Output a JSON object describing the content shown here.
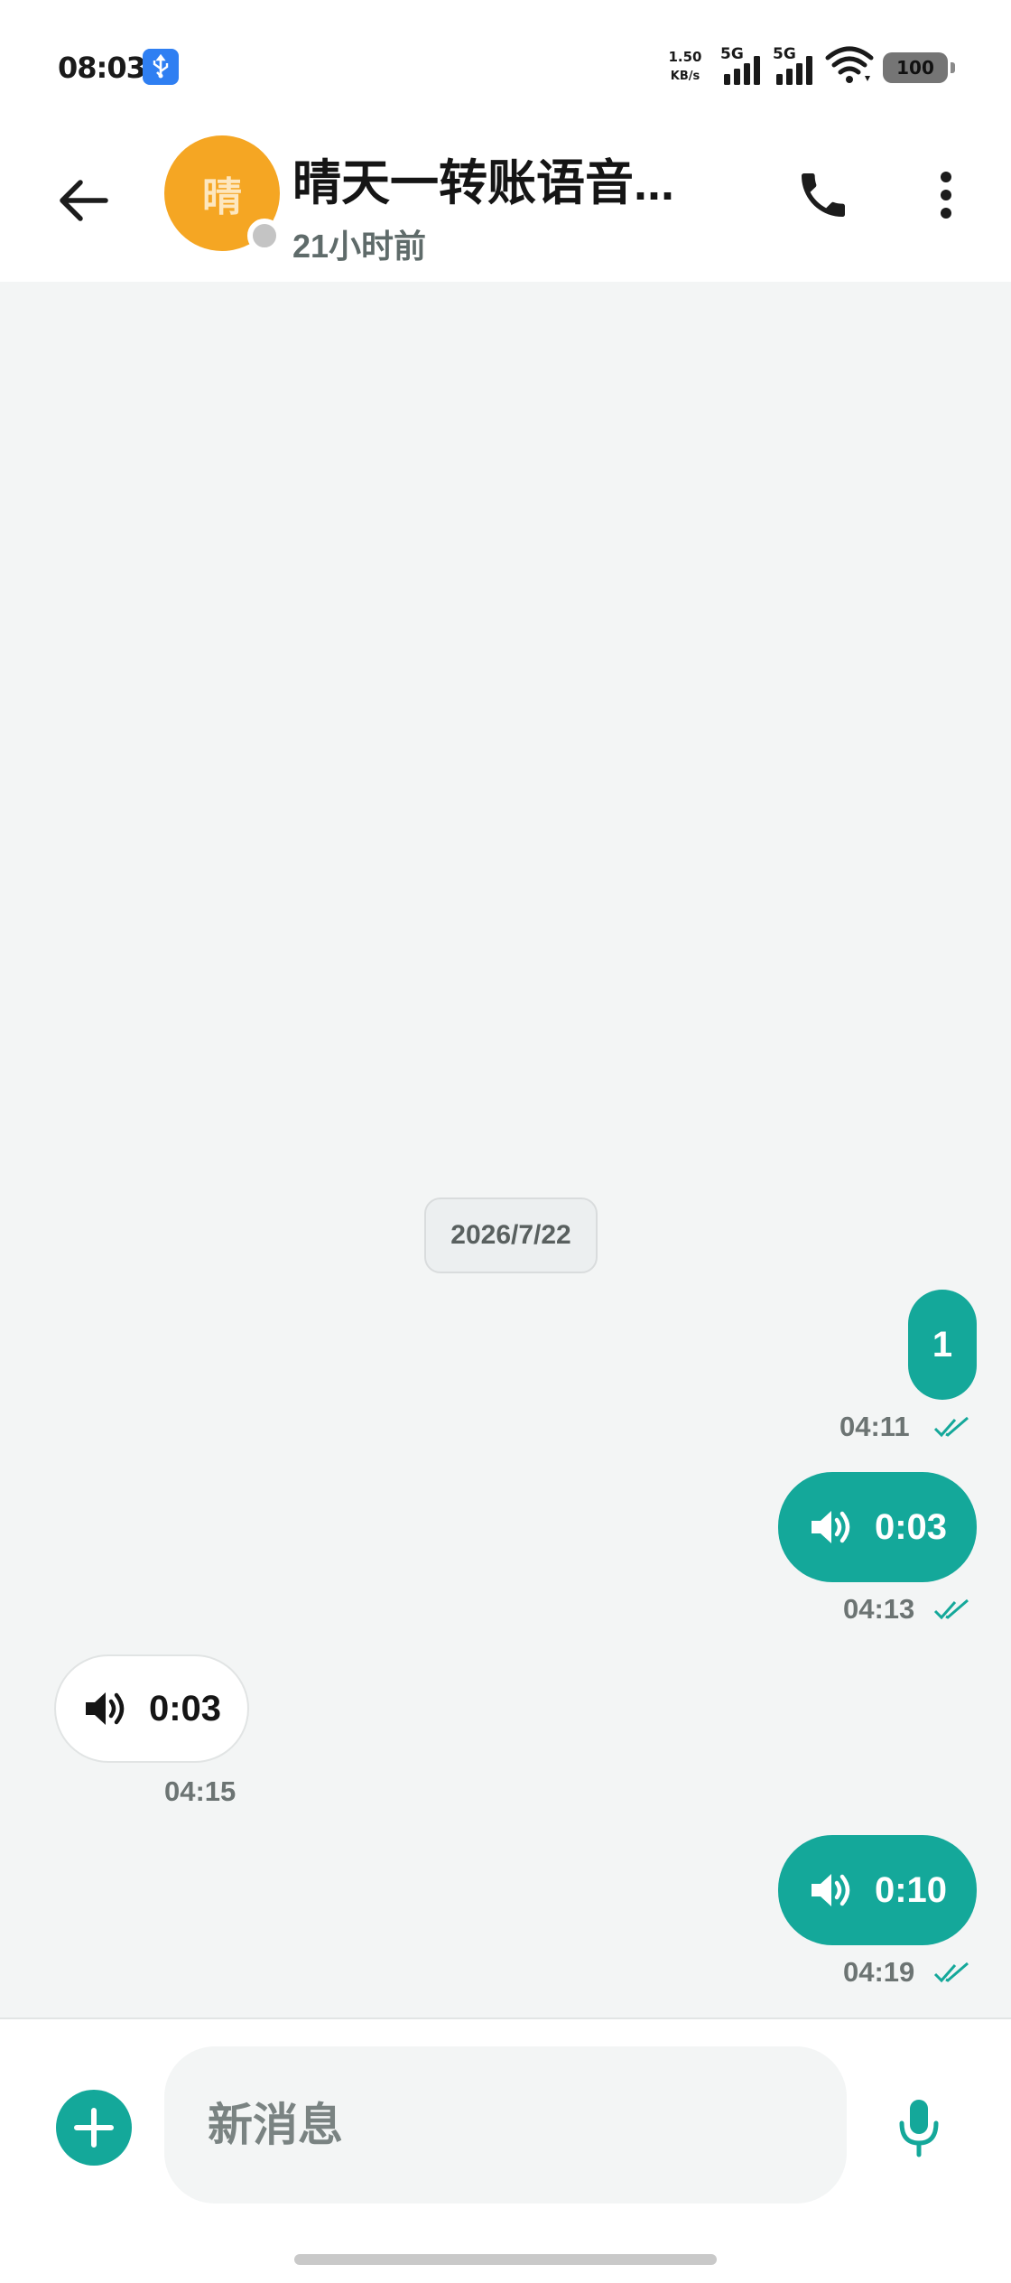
{
  "status_bar": {
    "time": "08:03",
    "net_speed_value": "1.50",
    "net_speed_unit": "KB/s",
    "signal_1_label": "5G",
    "signal_2_label": "5G",
    "battery": "100",
    "usb_icon": "usb-icon",
    "wifi_icon": "wifi-icon"
  },
  "header": {
    "back_icon": "arrow-left-icon",
    "avatar_initial": "晴",
    "title": "晴天一转账语音...",
    "subtitle": "21小时前",
    "call_icon": "phone-icon",
    "more_icon": "more-vertical-icon"
  },
  "messages": {
    "date_separator": "2026/7/22",
    "items": [
      {
        "direction": "outgoing",
        "type": "text",
        "text": "1",
        "time": "04:11",
        "status": "read"
      },
      {
        "direction": "outgoing",
        "type": "voice",
        "duration": "0:03",
        "time": "04:13",
        "status": "read"
      },
      {
        "direction": "incoming",
        "type": "voice",
        "duration": "0:03",
        "time": "04:15"
      },
      {
        "direction": "outgoing",
        "type": "voice",
        "duration": "0:10",
        "time": "04:19",
        "status": "read"
      }
    ]
  },
  "composer": {
    "add_icon": "plus-icon",
    "placeholder": "新消息",
    "value": "",
    "mic_icon": "microphone-icon"
  },
  "colors": {
    "accent": "#14a89a",
    "avatar": "#f5a623",
    "chat_background": "#f3f5f5"
  }
}
